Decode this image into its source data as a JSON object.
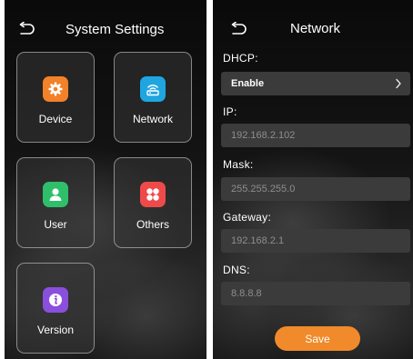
{
  "system_settings": {
    "title": "System Settings",
    "tiles": [
      {
        "label": "Device",
        "icon": "gear-icon",
        "color": "#f2812a"
      },
      {
        "label": "Network",
        "icon": "router-icon",
        "color": "#1fa6e0"
      },
      {
        "label": "User",
        "icon": "user-icon",
        "color": "#2fbf6a"
      },
      {
        "label": "Others",
        "icon": "grid-icon",
        "color": "#ef4a4a"
      },
      {
        "label": "Version",
        "icon": "info-icon",
        "color": "#8a4fdc"
      }
    ]
  },
  "network": {
    "title": "Network",
    "dhcp_label": "DHCP:",
    "dhcp_value": "Enable",
    "ip_label": "IP:",
    "ip_placeholder": "192.168.2.102",
    "mask_label": "Mask:",
    "mask_placeholder": "255.255.255.0",
    "gateway_label": "Gateway:",
    "gateway_placeholder": "192.168.2.1",
    "dns_label": "DNS:",
    "dns_placeholder": "8.8.8.8",
    "save_label": "Save",
    "save_color": "#f08a2a"
  }
}
